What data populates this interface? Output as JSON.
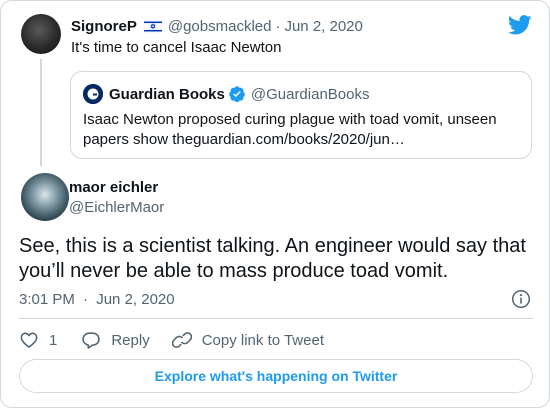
{
  "parent": {
    "name": "SignoreP",
    "handle": "@gobsmackled",
    "separator": "·",
    "date": "Jun 2, 2020",
    "text": "It's time to cancel Isaac Newton",
    "flag_icon": "israel-flag-icon"
  },
  "quote": {
    "name": "Guardian Books",
    "handle": "@GuardianBooks",
    "text": "Isaac Newton proposed curing plague with toad vomit, unseen papers show theguardian.com/books/2020/jun…",
    "verified_icon": "verified-badge-icon"
  },
  "tweet": {
    "name": "maor eichler",
    "handle": "@EichlerMaor",
    "text": "See, this is a scientist talking. An engineer would say that you’ll never be able to mass produce toad vomit.",
    "time": "3:01 PM",
    "separator": "·",
    "date": "Jun 2, 2020"
  },
  "actions": {
    "like_count": "1",
    "reply_label": "Reply",
    "copy_label": "Copy link to Tweet"
  },
  "footer": {
    "explore_label": "Explore what's happening on Twitter"
  },
  "colors": {
    "accent": "#1d9bf0",
    "secondary_text": "#536471",
    "border": "#cfd9de",
    "text": "#0f1419"
  }
}
